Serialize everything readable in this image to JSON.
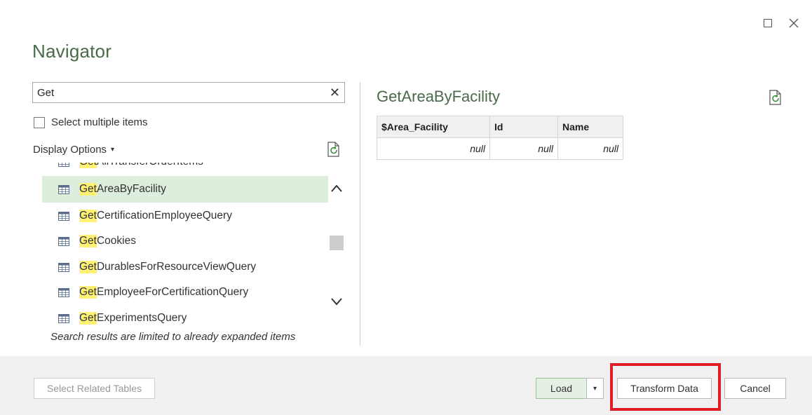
{
  "window": {
    "maximize_icon": "square-icon",
    "close_icon": "close-icon"
  },
  "title": "Navigator",
  "search": {
    "value": "Get",
    "clear_label": "✕"
  },
  "select_multiple": {
    "label": "Select multiple items",
    "checked": false
  },
  "display_options": {
    "label": "Display Options",
    "caret": "▾"
  },
  "list": {
    "items": [
      {
        "match": "Get",
        "rest": "AllTransferOrderItems",
        "selected": false
      },
      {
        "match": "Get",
        "rest": "AreaByFacility",
        "selected": true
      },
      {
        "match": "Get",
        "rest": "CertificationEmployeeQuery",
        "selected": false
      },
      {
        "match": "Get",
        "rest": "Cookies",
        "selected": false
      },
      {
        "match": "Get",
        "rest": "DurablesForResourceViewQuery",
        "selected": false
      },
      {
        "match": "Get",
        "rest": "EmployeeForCertificationQuery",
        "selected": false
      },
      {
        "match": "Get",
        "rest": "ExperimentsQuery",
        "selected": false
      }
    ],
    "note": "Search results are limited to already expanded items"
  },
  "preview": {
    "title": "GetAreaByFacility",
    "columns": [
      "$Area_Facility",
      "Id",
      "Name"
    ],
    "rows": [
      [
        "null",
        "null",
        "null"
      ]
    ]
  },
  "footer": {
    "select_related": "Select Related Tables",
    "load": "Load",
    "load_caret": "▾",
    "transform": "Transform Data",
    "cancel": "Cancel"
  },
  "colors": {
    "accent_green": "#4a6a4a",
    "selection": "#ddeedd",
    "highlight": "#fff176",
    "annotation_red": "#e01e26"
  }
}
